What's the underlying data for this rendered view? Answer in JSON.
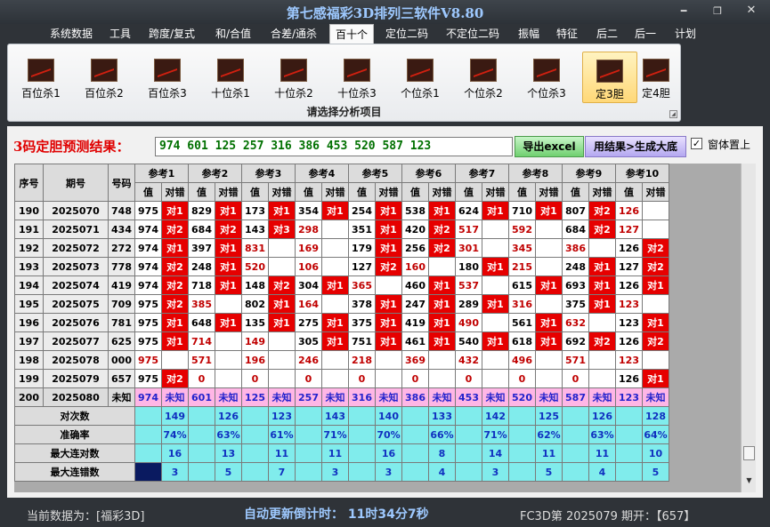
{
  "window": {
    "title": "第七感福彩3D排列三软件V8.80"
  },
  "menu": [
    "系统数据",
    "工具",
    "跨度/复式",
    "和/合值",
    "合差/通杀",
    "百十个",
    "定位二码",
    "不定位二码",
    "振幅",
    "特征",
    "后二",
    "后一",
    "计划"
  ],
  "ribbon": {
    "buttons": [
      "百位杀1",
      "百位杀2",
      "百位杀3",
      "十位杀1",
      "十位杀2",
      "十位杀3",
      "个位杀1",
      "个位杀2",
      "个位杀3",
      "定3胆",
      "定4胆"
    ],
    "caption": "请选择分析项目"
  },
  "predict": {
    "label": "3码定胆预测结果：",
    "value": "974 601 125 257 316 386 453 520 587 123",
    "btn_excel": "导出excel",
    "btn_big": "用结果>生成大底",
    "topmost_label": "窗体置上"
  },
  "grid": {
    "h_no": "序号",
    "h_period": "期号",
    "h_code": "号码",
    "h_val": "值",
    "h_ok": "对错",
    "refs": [
      "参考1",
      "参考2",
      "参考3",
      "参考4",
      "参考5",
      "参考6",
      "参考7",
      "参考8",
      "参考9",
      "参考10"
    ],
    "rows": [
      {
        "no": "190",
        "period": "2025070",
        "code": "748",
        "cells": [
          [
            "975",
            "对1"
          ],
          [
            "829",
            "对1"
          ],
          [
            "173",
            "对1"
          ],
          [
            "354",
            "对1"
          ],
          [
            "254",
            "对1"
          ],
          [
            "538",
            "对1"
          ],
          [
            "624",
            "对1"
          ],
          [
            "710",
            "对1"
          ],
          [
            "807",
            "对2"
          ],
          [
            "126",
            ""
          ]
        ]
      },
      {
        "no": "191",
        "period": "2025071",
        "code": "434",
        "cells": [
          [
            "974",
            "对2"
          ],
          [
            "684",
            "对2"
          ],
          [
            "143",
            "对3"
          ],
          [
            "298",
            ""
          ],
          [
            "351",
            "对1"
          ],
          [
            "420",
            "对2"
          ],
          [
            "517",
            ""
          ],
          [
            "592",
            ""
          ],
          [
            "684",
            "对2"
          ],
          [
            "127",
            ""
          ]
        ]
      },
      {
        "no": "192",
        "period": "2025072",
        "code": "272",
        "cells": [
          [
            "974",
            "对1"
          ],
          [
            "397",
            "对1"
          ],
          [
            "831",
            ""
          ],
          [
            "169",
            ""
          ],
          [
            "179",
            "对1"
          ],
          [
            "256",
            "对2"
          ],
          [
            "301",
            ""
          ],
          [
            "345",
            ""
          ],
          [
            "386",
            ""
          ],
          [
            "126",
            "对2"
          ]
        ]
      },
      {
        "no": "193",
        "period": "2025073",
        "code": "778",
        "cells": [
          [
            "974",
            "对2"
          ],
          [
            "248",
            "对1"
          ],
          [
            "520",
            ""
          ],
          [
            "106",
            ""
          ],
          [
            "127",
            "对2"
          ],
          [
            "160",
            ""
          ],
          [
            "180",
            "对1"
          ],
          [
            "215",
            ""
          ],
          [
            "248",
            "对1"
          ],
          [
            "127",
            "对2"
          ]
        ]
      },
      {
        "no": "194",
        "period": "2025074",
        "code": "419",
        "cells": [
          [
            "974",
            "对2"
          ],
          [
            "718",
            "对1"
          ],
          [
            "148",
            "对2"
          ],
          [
            "304",
            "对1"
          ],
          [
            "365",
            ""
          ],
          [
            "460",
            "对1"
          ],
          [
            "537",
            ""
          ],
          [
            "615",
            "对1"
          ],
          [
            "693",
            "对1"
          ],
          [
            "126",
            "对1"
          ]
        ]
      },
      {
        "no": "195",
        "period": "2025075",
        "code": "709",
        "cells": [
          [
            "975",
            "对2"
          ],
          [
            "385",
            ""
          ],
          [
            "802",
            "对1"
          ],
          [
            "164",
            ""
          ],
          [
            "378",
            "对1"
          ],
          [
            "247",
            "对1"
          ],
          [
            "289",
            "对1"
          ],
          [
            "316",
            ""
          ],
          [
            "375",
            "对1"
          ],
          [
            "123",
            ""
          ]
        ]
      },
      {
        "no": "196",
        "period": "2025076",
        "code": "781",
        "cells": [
          [
            "975",
            "对1"
          ],
          [
            "648",
            "对1"
          ],
          [
            "135",
            "对1"
          ],
          [
            "275",
            "对1"
          ],
          [
            "375",
            "对1"
          ],
          [
            "419",
            "对1"
          ],
          [
            "490",
            ""
          ],
          [
            "561",
            "对1"
          ],
          [
            "632",
            ""
          ],
          [
            "123",
            "对1"
          ]
        ]
      },
      {
        "no": "197",
        "period": "2025077",
        "code": "625",
        "cells": [
          [
            "975",
            "对1"
          ],
          [
            "714",
            ""
          ],
          [
            "149",
            ""
          ],
          [
            "305",
            "对1"
          ],
          [
            "751",
            "对1"
          ],
          [
            "461",
            "对1"
          ],
          [
            "540",
            "对1"
          ],
          [
            "618",
            "对1"
          ],
          [
            "692",
            "对2"
          ],
          [
            "126",
            "对2"
          ]
        ]
      },
      {
        "no": "198",
        "period": "2025078",
        "code": "000",
        "cells": [
          [
            "975",
            ""
          ],
          [
            "571",
            ""
          ],
          [
            "196",
            ""
          ],
          [
            "246",
            ""
          ],
          [
            "218",
            ""
          ],
          [
            "369",
            ""
          ],
          [
            "432",
            ""
          ],
          [
            "496",
            ""
          ],
          [
            "571",
            ""
          ],
          [
            "123",
            ""
          ]
        ]
      },
      {
        "no": "199",
        "period": "2025079",
        "code": "657",
        "cells": [
          [
            "975",
            "对2"
          ],
          [
            "0",
            ""
          ],
          [
            "0",
            ""
          ],
          [
            "0",
            ""
          ],
          [
            "0",
            ""
          ],
          [
            "0",
            ""
          ],
          [
            "0",
            ""
          ],
          [
            "0",
            ""
          ],
          [
            "0",
            ""
          ],
          [
            "126",
            "对1"
          ]
        ]
      }
    ],
    "predict_row": {
      "no": "200",
      "period": "2025080",
      "code": "未知",
      "vals": [
        "974",
        "601",
        "125",
        "257",
        "316",
        "386",
        "453",
        "520",
        "587",
        "123"
      ],
      "unknown": "未知"
    },
    "stats": [
      {
        "label": "对次数",
        "vals": [
          "149",
          "126",
          "123",
          "143",
          "140",
          "133",
          "142",
          "125",
          "126",
          "128"
        ]
      },
      {
        "label": "准确率",
        "vals": [
          "74%",
          "63%",
          "61%",
          "71%",
          "70%",
          "66%",
          "71%",
          "62%",
          "63%",
          "64%"
        ]
      },
      {
        "label": "最大连对数",
        "vals": [
          "16",
          "13",
          "11",
          "11",
          "16",
          "8",
          "14",
          "11",
          "11",
          "10"
        ]
      },
      {
        "label": "最大连错数",
        "vals": [
          "3",
          "5",
          "7",
          "3",
          "3",
          "4",
          "3",
          "5",
          "4",
          "5"
        ]
      }
    ]
  },
  "status": {
    "current": "当前数据为：[福彩3D]",
    "countdown": "自动更新倒计时：  11时34分7秒",
    "period": "FC3D第 2025079 期开：【657】"
  },
  "colors": {
    "hit": "#e60000",
    "predict_row": "#ffb6e6",
    "stats": "#80ecec",
    "title": "#9ec9ff"
  }
}
